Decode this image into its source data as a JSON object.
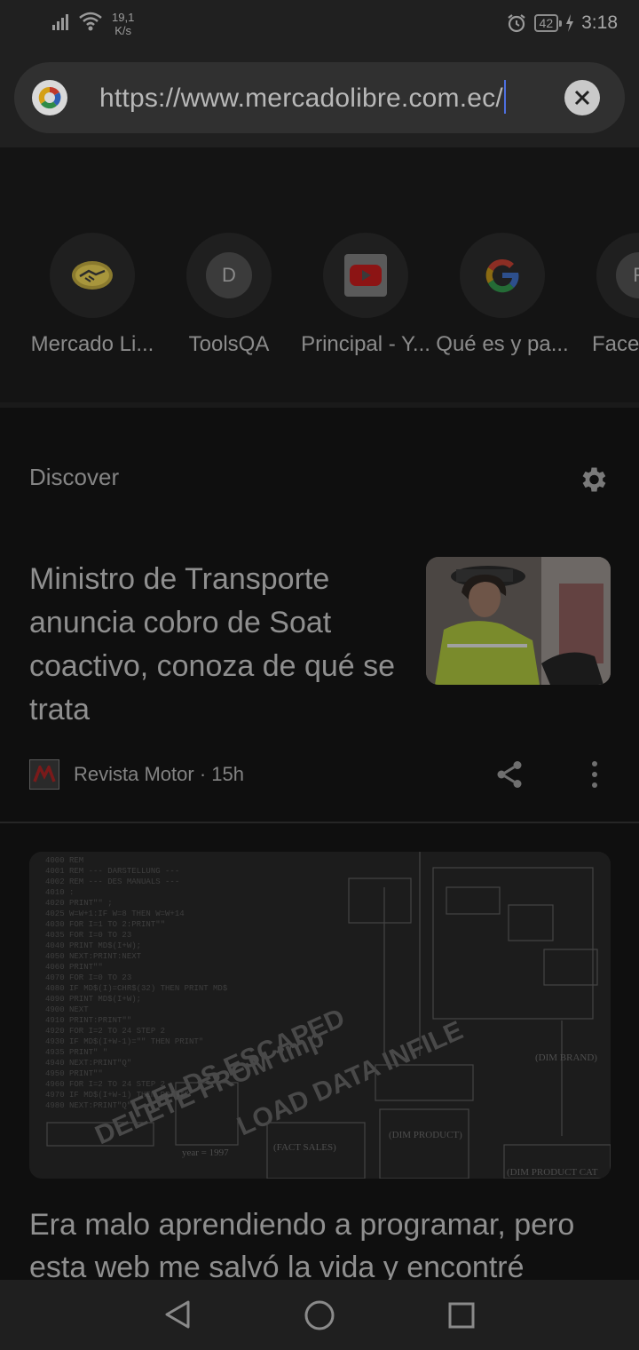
{
  "status_bar": {
    "speed_value": "19,1",
    "speed_unit": "K/s",
    "battery": "42",
    "time": "3:18"
  },
  "url_bar": {
    "url": "https://www.mercadolibre.com.ec/"
  },
  "shortcuts": [
    {
      "label": "Mercado Li...",
      "icon": "handshake-icon"
    },
    {
      "label": "ToolsQA",
      "letter": "D"
    },
    {
      "label": "Principal - Y...",
      "icon": "youtube-icon"
    },
    {
      "label": "Qué es y pa...",
      "icon": "google-icon"
    },
    {
      "label": "Face",
      "letter": "F"
    }
  ],
  "discover": {
    "title": "Discover"
  },
  "article1": {
    "title": "Ministro de Transporte anuncia cobro de Soat coactivo, conoza de qué se trata",
    "source": "Revista Motor · 15h"
  },
  "article2": {
    "title": "Era malo aprendiendo a programar, pero esta web me salvó la vida y encontré"
  },
  "colors": {
    "background": "#0f0f0f",
    "url_caret": "#4d6fe0"
  }
}
